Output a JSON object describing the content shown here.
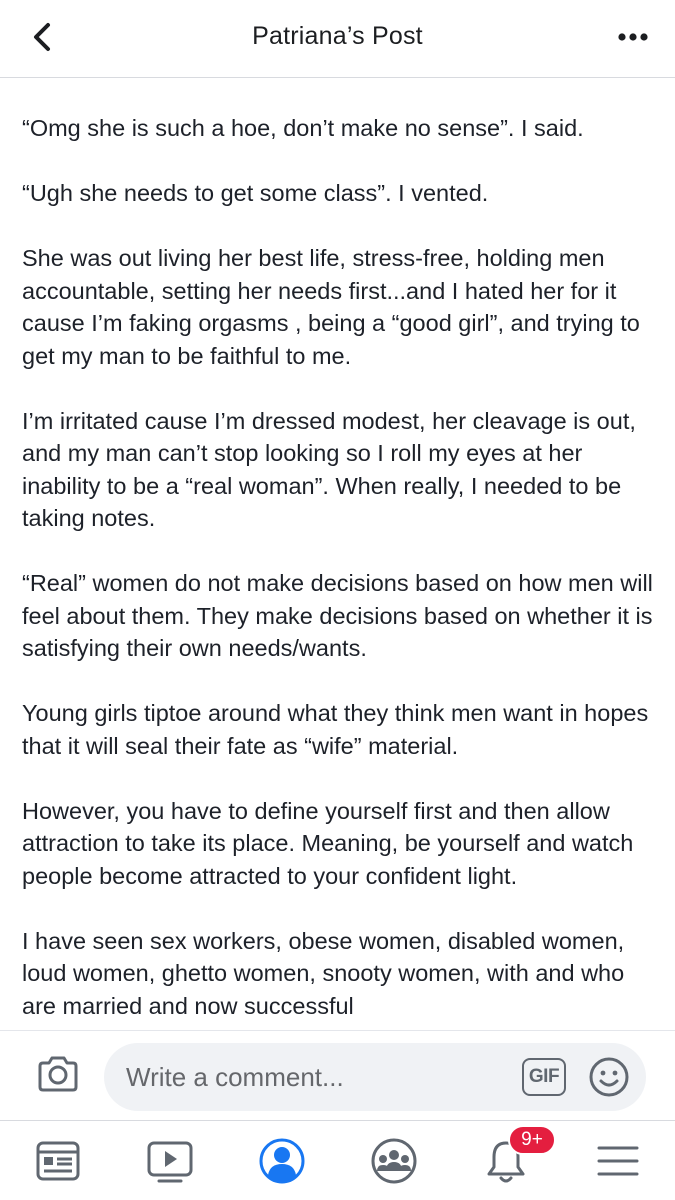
{
  "header": {
    "title": "Patriana’s Post",
    "back_icon": "chevron-left-icon",
    "more_icon": "more-horizontal-icon"
  },
  "post": {
    "paragraphs": [
      "“Omg she is such a hoe, don’t make no sense”. I said.",
      "“Ugh she needs to get some class”. I vented.",
      "She was out living her best life, stress-free, holding men accountable, setting her needs first...and I hated her for it cause I’m faking orgasms , being a “good girl”, and trying to get my man to be faithful to me.",
      "I’m irritated cause I’m dressed modest, her cleavage is out, and my man can’t stop looking so I roll my eyes at her inability to be a “real woman”. When really, I needed to be taking notes.",
      "“Real” women do not make decisions based on how men will feel about them. They make decisions based on whether it is satisfying their own needs/wants.",
      "Young girls tiptoe around what they think men want in hopes that it will seal their fate as “wife” material.",
      "However, you have to define yourself first and then allow attraction to take its place. Meaning, be yourself and watch people become attracted to your confident light.",
      "I have seen sex workers, obese women, disabled women, loud women, ghetto women, snooty women, with and who are married and now successful"
    ]
  },
  "comment_bar": {
    "placeholder": "Write a comment...",
    "gif_label": "GIF",
    "camera_icon": "camera-icon",
    "emoji_icon": "smiley-icon"
  },
  "tab_bar": {
    "tabs": [
      {
        "name": "news-feed",
        "icon": "news-feed-icon"
      },
      {
        "name": "watch",
        "icon": "video-play-icon"
      },
      {
        "name": "profile",
        "icon": "profile-icon",
        "active": true
      },
      {
        "name": "groups",
        "icon": "groups-icon"
      },
      {
        "name": "notifications",
        "icon": "bell-icon"
      },
      {
        "name": "menu",
        "icon": "hamburger-menu-icon"
      }
    ],
    "notification_badge": "9+"
  },
  "colors": {
    "accent": "#1877f2",
    "icon_gray": "#606770",
    "badge_red": "#e41e3f",
    "input_bg": "#f0f2f5"
  }
}
